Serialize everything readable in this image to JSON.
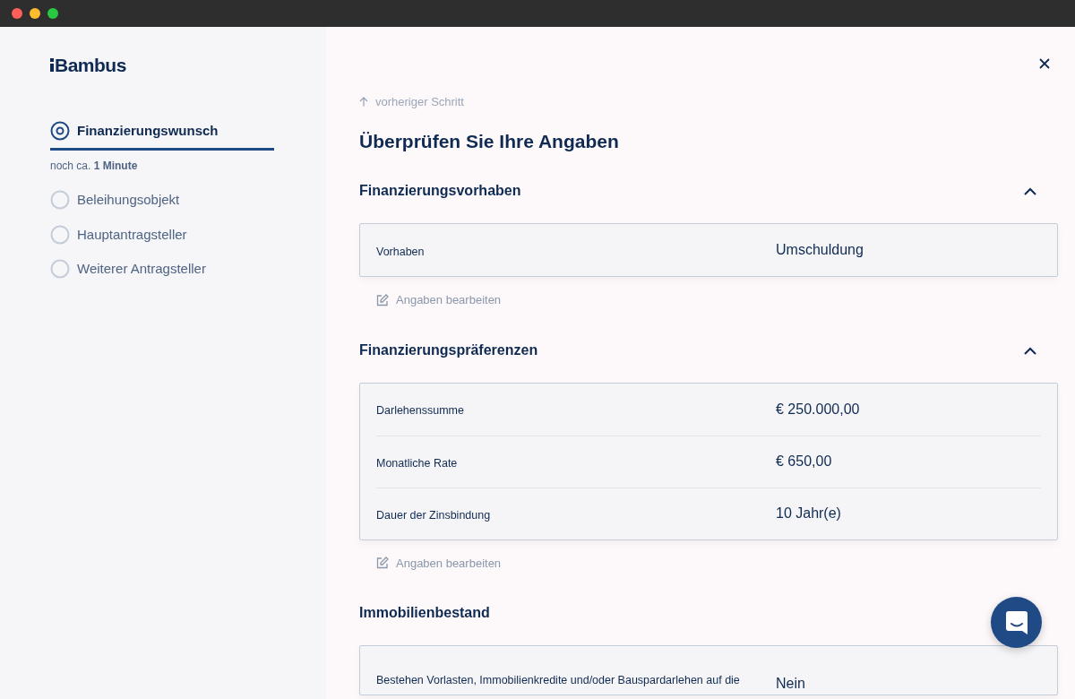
{
  "logo": "Bambus",
  "steps": [
    {
      "label": "Finanzierungswunsch",
      "selected": true,
      "hint": "noch ca. **1 Minute**"
    },
    {
      "label": "Beleihungsobjekt",
      "selected": false
    },
    {
      "label": "Hauptantragsteller",
      "selected": false
    },
    {
      "label": "Weiterer Antragsteller",
      "selected": false
    }
  ],
  "back_link": "vorheriger Schritt",
  "heading": "Überprüfen Sie Ihre Angaben",
  "sections": [
    {
      "title": "Finanzierungsvorhaben",
      "expanded": true,
      "rows": [
        {
          "label": "Vorhaben",
          "value": "Umschuldung"
        }
      ],
      "edit_label": "Angaben bearbeiten"
    },
    {
      "title": "Finanzierungspräferenzen",
      "expanded": true,
      "rows": [
        {
          "label": "Darlehenssumme",
          "value": "€ 250.000,00"
        },
        {
          "label": "Monatliche Rate",
          "value": "€ 650,00"
        },
        {
          "label": "Dauer der Zinsbindung",
          "value": "10 Jahr(e)"
        }
      ],
      "edit_label": "Angaben bearbeiten"
    },
    {
      "title": "Immobilienbestand",
      "rows": [
        {
          "label": "Bestehen Vorlasten, Immobilienkredite und/oder Bauspardarlehen auf die",
          "value": "Nein"
        }
      ]
    }
  ]
}
